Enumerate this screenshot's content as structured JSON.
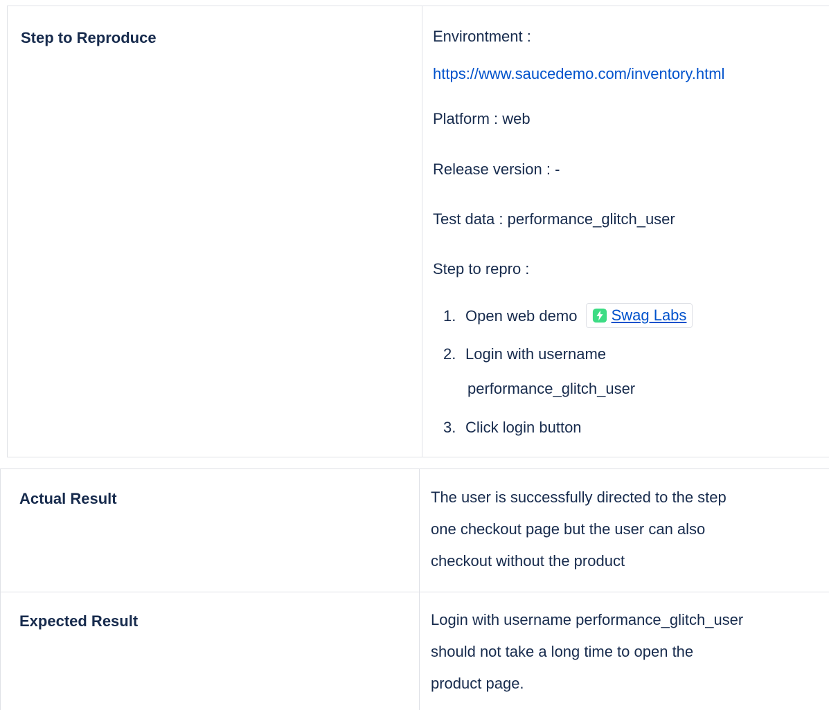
{
  "step_to_reproduce": {
    "label": "Step to Reproduce",
    "environment_label": "Environtment :",
    "environment_url": "https://www.saucedemo.com/inventory.html",
    "platform": "Platform : web",
    "release_version": "Release version : -",
    "test_data": "Test data : performance_glitch_user",
    "step_to_repro_label": "Step to repro :",
    "steps": [
      {
        "num": "1.",
        "text": "Open web demo",
        "chip_label": "Swag Labs"
      },
      {
        "num": "2.",
        "text": "Login with username",
        "text_cont": "performance_glitch_user"
      },
      {
        "num": "3.",
        "text": "Click login button"
      }
    ]
  },
  "actual_result": {
    "label": "Actual Result",
    "lines": [
      "The user is successfully directed to the step",
      "one checkout page but the user can also",
      "checkout without the product"
    ]
  },
  "expected_result": {
    "label": "Expected Result",
    "lines": [
      "Login with username performance_glitch_user",
      "should not take a long time to open the",
      "product page."
    ]
  },
  "colors": {
    "text": "#172b4d",
    "link": "#0052cc",
    "border": "#dfe1e6",
    "chip_icon": "#3ddc84"
  },
  "icons": {
    "chip_icon": "swag-labs-logo-icon"
  }
}
